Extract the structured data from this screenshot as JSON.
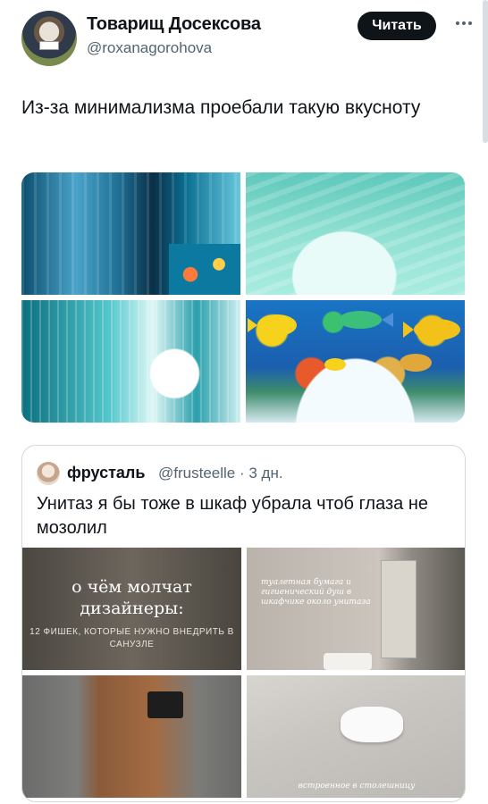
{
  "post": {
    "author": {
      "display_name": "Товарищ Досексова",
      "handle": "@roxanagorohova",
      "follow_label": "Читать"
    },
    "text": "Из-за минимализма проебали такую вкусноту",
    "media": [
      "media-1",
      "media-2",
      "media-3",
      "media-4"
    ]
  },
  "quote": {
    "author": {
      "display_name": "фрусталь",
      "handle_time": "@frusteelle · 3 дн."
    },
    "text": "Унитаз я бы тоже в шкаф убрала чтоб глаза не мозолил",
    "media": {
      "tile1_title": "о чём молчат дизайнеры:",
      "tile1_sub": "12 ФИШЕК, КОТОРЫЕ НУЖНО ВНЕДРИТЬ В САНУЗЛЕ",
      "tile2_caption": "туалетная бумага и гигиенический душ в шкафчике около унитаза",
      "tile4_caption": "встроенное в столешницу"
    }
  }
}
